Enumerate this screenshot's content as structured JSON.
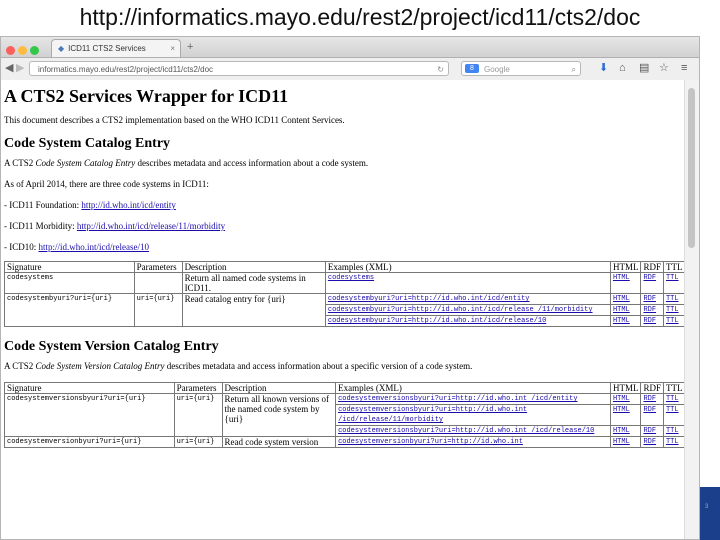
{
  "slide": {
    "title": "http://informatics.mayo.edu/rest2/project/icd11/cts2/doc"
  },
  "browser": {
    "tab_title": "ICD11 CTS2 Services",
    "tab_close": "×",
    "new_tab": "+",
    "back": "◀",
    "forward": "▶",
    "url": "informatics.mayo.edu/rest2/project/icd11/cts2/doc",
    "search_engine": "8",
    "search_placeholder": "Google",
    "reload": "↻"
  },
  "doc": {
    "h1": "A CTS2 Services Wrapper for ICD11",
    "intro": "This document describes a CTS2 implementation based on the WHO ICD11 Content Services.",
    "section1": {
      "heading": "Code System Catalog Entry",
      "desc_pre": "A CTS2 ",
      "desc_em": "Code System Catalog Entry",
      "desc_post": " describes metadata and access information about a code system.",
      "asof": "As of April 2014, there are three code systems in ICD11:",
      "systems": [
        {
          "label": "- ICD11 Foundation: ",
          "link": "http://id.who.int/icd/entity"
        },
        {
          "label": "- ICD11 Morbidity: ",
          "link": "http://id.who.int/icd/release/11/morbidity"
        },
        {
          "label": "- ICD10: ",
          "link": "http://id.who.int/icd/release/10"
        }
      ],
      "table": {
        "headers": [
          "Signature",
          "Parameters",
          "Description",
          "Examples (XML)",
          "HTML",
          "RDF",
          "TTL"
        ],
        "rows": [
          {
            "sig": "codesystems",
            "params": "",
            "desc": "Return all named code systems in ICD11.",
            "examples": [
              "codesystems"
            ]
          },
          {
            "sig": "codesystembyuri?uri={uri}",
            "params": "uri={uri}",
            "desc": "Read catalog entry for {uri}",
            "examples": [
              "codesystembyuri?uri=http://id.who.int/icd/entity",
              "codesystembyuri?uri=http://id.who.int/icd/release /11/morbidity",
              "codesystembyuri?uri=http://id.who.int/icd/release/10"
            ]
          }
        ]
      }
    },
    "section2": {
      "heading": "Code System Version Catalog Entry",
      "desc_pre": "A CTS2 ",
      "desc_em": "Code System Version Catalog Entry",
      "desc_post": " describes metadata and access information about a specific version of a code system.",
      "table": {
        "headers": [
          "Signature",
          "Parameters",
          "Description",
          "Examples (XML)",
          "HTML",
          "RDF",
          "TTL"
        ],
        "rows": [
          {
            "sig": "codesystemversionsbyuri?uri={uri}",
            "params": "uri={uri}",
            "desc": "Return all known versions of the named code system by {uri}",
            "examples": [
              "codesystemversionsbyuri?uri=http://id.who.int /icd/entity",
              "codesystemversionsbyuri?uri=http://id.who.int /icd/release/11/morbidity",
              "codesystemversionsbyuri?uri=http://id.who.int /icd/release/10"
            ]
          },
          {
            "sig": "codesystemversionbyuri?uri={uri}",
            "params": "uri={uri}",
            "desc": "Read code system version",
            "examples": [
              "codesystemversionbyuri?uri=http://id.who.int"
            ]
          }
        ]
      }
    },
    "formats": {
      "html": "HTML",
      "rdf": "RDF",
      "ttl": "TTL"
    }
  },
  "slide_number": "3",
  "colors": {
    "link": "#1a0dab",
    "slide_bar": "#1b3f8b"
  }
}
